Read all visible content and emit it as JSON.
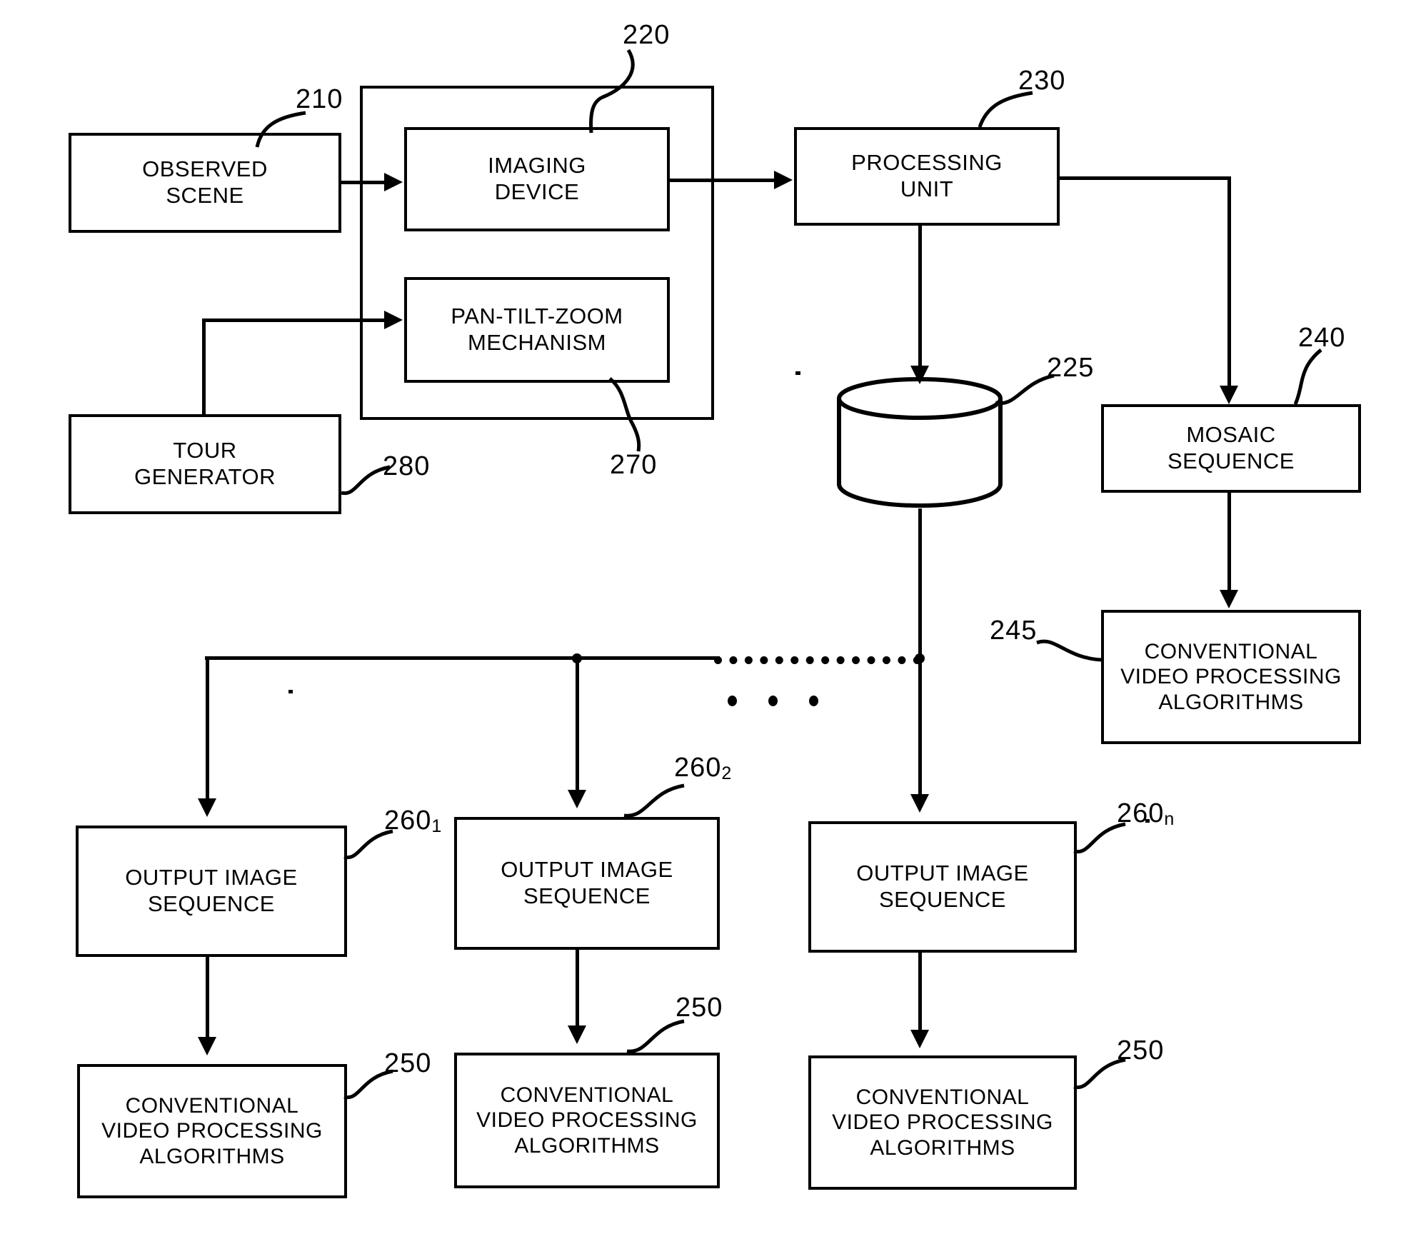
{
  "figure": {
    "type": "patent-block-diagram",
    "nodes": [
      {
        "id": "observed_scene",
        "lines": [
          "OBSERVED",
          "SCENE"
        ]
      },
      {
        "id": "imaging_device",
        "lines": [
          "IMAGING",
          "DEVICE"
        ]
      },
      {
        "id": "ptz_mechanism",
        "lines": [
          "PAN-TILT-ZOOM",
          "MECHANISM"
        ]
      },
      {
        "id": "tour_generator",
        "lines": [
          "TOUR",
          "GENERATOR"
        ]
      },
      {
        "id": "processing_unit",
        "lines": [
          "PROCESSING",
          "UNIT"
        ]
      },
      {
        "id": "mosaic_sequence",
        "lines": [
          "MOSAIC",
          "SEQUENCE"
        ]
      },
      {
        "id": "cvpa_mosaic",
        "lines": [
          "CONVENTIONAL",
          "VIDEO PROCESSING",
          "ALGORITHMS"
        ]
      },
      {
        "id": "output_seq_1",
        "lines": [
          "OUTPUT IMAGE",
          "SEQUENCE"
        ]
      },
      {
        "id": "output_seq_2",
        "lines": [
          "OUTPUT IMAGE",
          "SEQUENCE"
        ]
      },
      {
        "id": "output_seq_n",
        "lines": [
          "OUTPUT IMAGE",
          "SEQUENCE"
        ]
      },
      {
        "id": "cvpa_1",
        "lines": [
          "CONVENTIONAL",
          "VIDEO PROCESSING",
          "ALGORITHMS"
        ]
      },
      {
        "id": "cvpa_2",
        "lines": [
          "CONVENTIONAL",
          "VIDEO PROCESSING",
          "ALGORITHMS"
        ]
      },
      {
        "id": "cvpa_n",
        "lines": [
          "CONVENTIONAL",
          "VIDEO PROCESSING",
          "ALGORITHMS"
        ]
      }
    ],
    "storage": {
      "id": "image_store",
      "label": ""
    },
    "reference_numerals": [
      {
        "id": "ref_210",
        "text": "210",
        "sub": "",
        "points_to": "observed_scene"
      },
      {
        "id": "ref_220",
        "text": "220",
        "sub": "",
        "points_to": "imaging_device"
      },
      {
        "id": "ref_230",
        "text": "230",
        "sub": "",
        "points_to": "processing_unit"
      },
      {
        "id": "ref_225",
        "text": "225",
        "sub": "",
        "points_to": "image_store"
      },
      {
        "id": "ref_240",
        "text": "240",
        "sub": "",
        "points_to": "mosaic_sequence"
      },
      {
        "id": "ref_245",
        "text": "245",
        "sub": "",
        "points_to": "cvpa_mosaic"
      },
      {
        "id": "ref_270",
        "text": "270",
        "sub": "",
        "points_to": "camera_group"
      },
      {
        "id": "ref_280",
        "text": "280",
        "sub": "",
        "points_to": "tour_generator"
      },
      {
        "id": "ref_260_1",
        "text": "260",
        "sub": "1",
        "points_to": "output_seq_1"
      },
      {
        "id": "ref_260_2",
        "text": "260",
        "sub": "2",
        "points_to": "output_seq_2"
      },
      {
        "id": "ref_260_n",
        "text": "260",
        "sub": "n",
        "points_to": "output_seq_n"
      },
      {
        "id": "ref_250_1",
        "text": "250",
        "sub": "",
        "points_to": "cvpa_1"
      },
      {
        "id": "ref_250_2",
        "text": "250",
        "sub": "",
        "points_to": "cvpa_2"
      },
      {
        "id": "ref_250_n",
        "text": "250",
        "sub": "",
        "points_to": "cvpa_n"
      }
    ],
    "ellipsis": "• • •",
    "colors": {
      "ink": "#000000",
      "paper": "#ffffff"
    }
  }
}
